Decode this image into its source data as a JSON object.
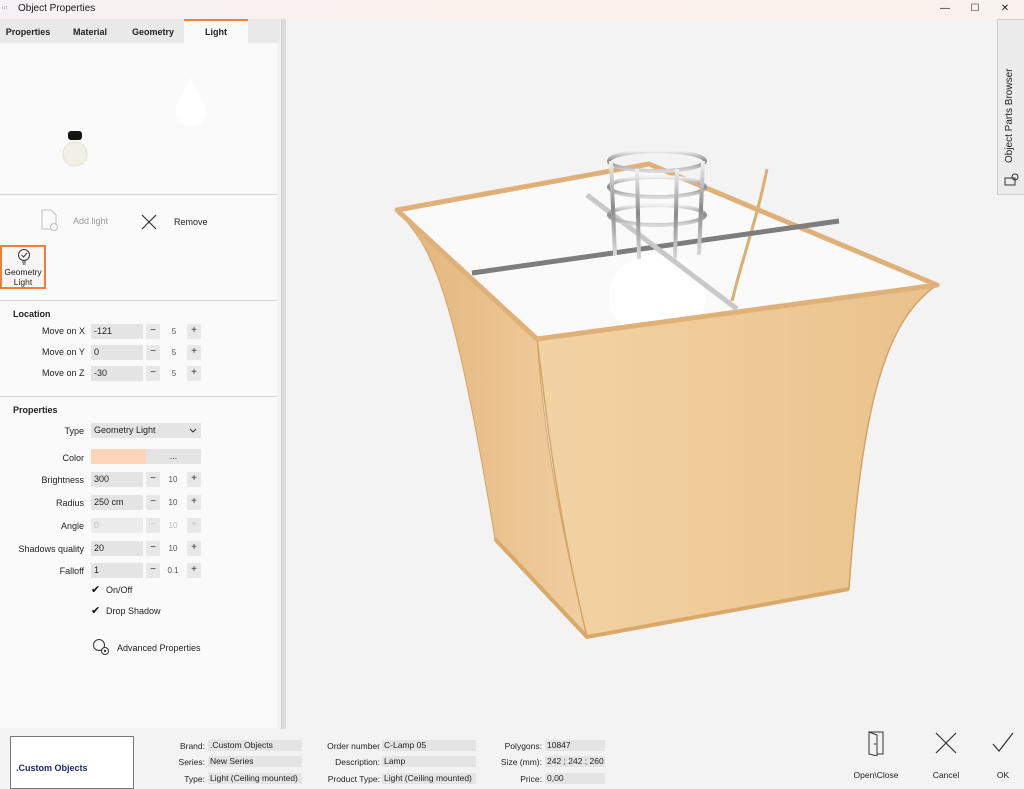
{
  "window": {
    "title": "Object Properties",
    "logo_text": "GT",
    "controls": {
      "minimize": "—",
      "maximize": "☐",
      "close": "✕"
    }
  },
  "tabs": [
    {
      "label": "Properties"
    },
    {
      "label": "Material"
    },
    {
      "label": "Geometry"
    },
    {
      "label": "Light",
      "active": true
    }
  ],
  "light_toolbar": {
    "add_label": "Add light",
    "remove_label": "Remove"
  },
  "light_list": [
    {
      "label": "Geometry Light",
      "selected": true
    }
  ],
  "location": {
    "heading": "Location",
    "rows": [
      {
        "label": "Move on X",
        "value": "-121",
        "step": "5"
      },
      {
        "label": "Move on Y",
        "value": "0",
        "step": "5"
      },
      {
        "label": "Move on Z",
        "value": "-30",
        "step": "5"
      }
    ]
  },
  "properties": {
    "heading": "Properties",
    "type_label": "Type",
    "type_value": "Geometry Light",
    "color_label": "Color",
    "color_hex": "#fdd4b8",
    "color_button": "...",
    "rows": [
      {
        "label": "Brightness",
        "value": "300",
        "step": "10"
      },
      {
        "label": "Radius",
        "value": "250 cm",
        "step": "10"
      },
      {
        "label": "Angle",
        "value": "0",
        "step": "10",
        "disabled": true
      },
      {
        "label": "Shadows quality",
        "value": "20",
        "step": "10"
      },
      {
        "label": "Falloff",
        "value": "1",
        "step": "0.1"
      }
    ],
    "on_off_label": "On/Off",
    "on_off_checked": true,
    "drop_shadow_label": "Drop Shadow",
    "drop_shadow_checked": true,
    "advanced_label": "Advanced Properties"
  },
  "side_panel": {
    "label": "Object Parts Browser"
  },
  "stepper": {
    "minus": "−",
    "plus": "+"
  },
  "info": {
    "logo_text": ".Custom Objects",
    "brand_label": "Brand:",
    "brand": ".Custom Objects",
    "series_label": "Series:",
    "series": "New Series",
    "type_label": "Type:",
    "type": "Light (Ceiling mounted)",
    "order_label": "Order number",
    "order": "C-Lamp 05",
    "description_label": "Description:",
    "description": "Lamp",
    "product_type_label": "Product Type:",
    "product_type": "Light (Ceiling mounted)",
    "polygons_label": "Polygons:",
    "polygons": "10847",
    "size_label": "Size (mm):",
    "size": "242 ; 242 ; 260",
    "price_label": "Price:",
    "price": "0,00"
  },
  "actions": {
    "open_close": "Open\\Close",
    "cancel": "Cancel",
    "ok": "OK"
  },
  "colors": {
    "accent": "#ef7d3c",
    "shade": "#e8c394",
    "shade_rim": "#d9ab6b"
  }
}
